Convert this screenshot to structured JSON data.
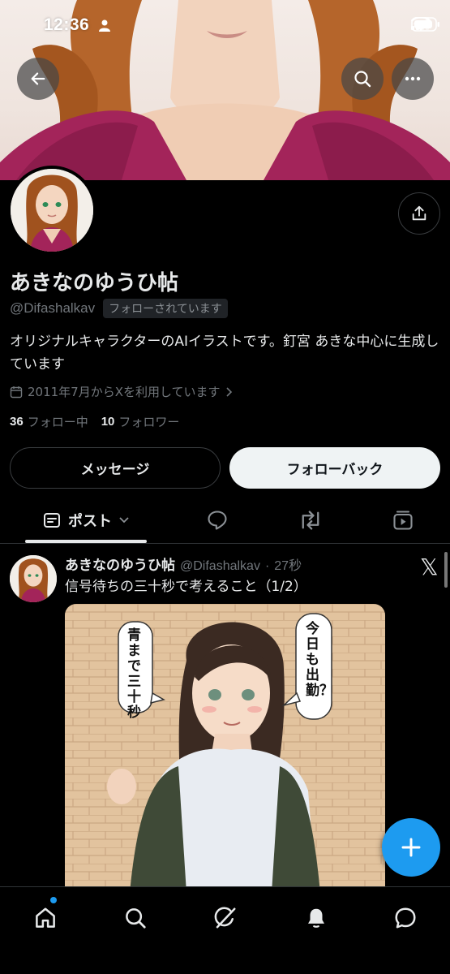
{
  "status_bar": {
    "time": "12:36"
  },
  "profile": {
    "display_name": "あきなのゆうひ帖",
    "handle": "@Difashalkav",
    "follows_you_badge": "フォローされています",
    "bio": "オリジナルキャラクターのAIイラストです。釘宮 あきな中心に生成しています",
    "joined": "2011年7月からXを利用しています",
    "following_count": "36",
    "following_label": "フォロー中",
    "followers_count": "10",
    "followers_label": "フォロワー",
    "message_button": "メッセージ",
    "follow_back_button": "フォローバック"
  },
  "tabs": {
    "posts_label": "ポスト",
    "items": [
      "posts-icon",
      "replies-icon",
      "repost-icon",
      "media-icon"
    ]
  },
  "tweet": {
    "name": "あきなのゆうひ帖",
    "handle": "@Difashalkav",
    "separator": "·",
    "time": "27秒",
    "text": "信号待ちの三十秒で考えること（1/2）",
    "image_speech_left": "青まで三十秒",
    "image_speech_right": "今日も出勤？",
    "logo": "𝕏"
  },
  "nav": {
    "items": [
      "home-icon",
      "search-icon",
      "grok-icon",
      "notifications-icon",
      "messages-icon"
    ],
    "active": "home-icon"
  },
  "colors": {
    "accent": "#1d9bf0",
    "background": "#000000",
    "text_primary": "#e7e9ea",
    "text_secondary": "#71767b"
  }
}
